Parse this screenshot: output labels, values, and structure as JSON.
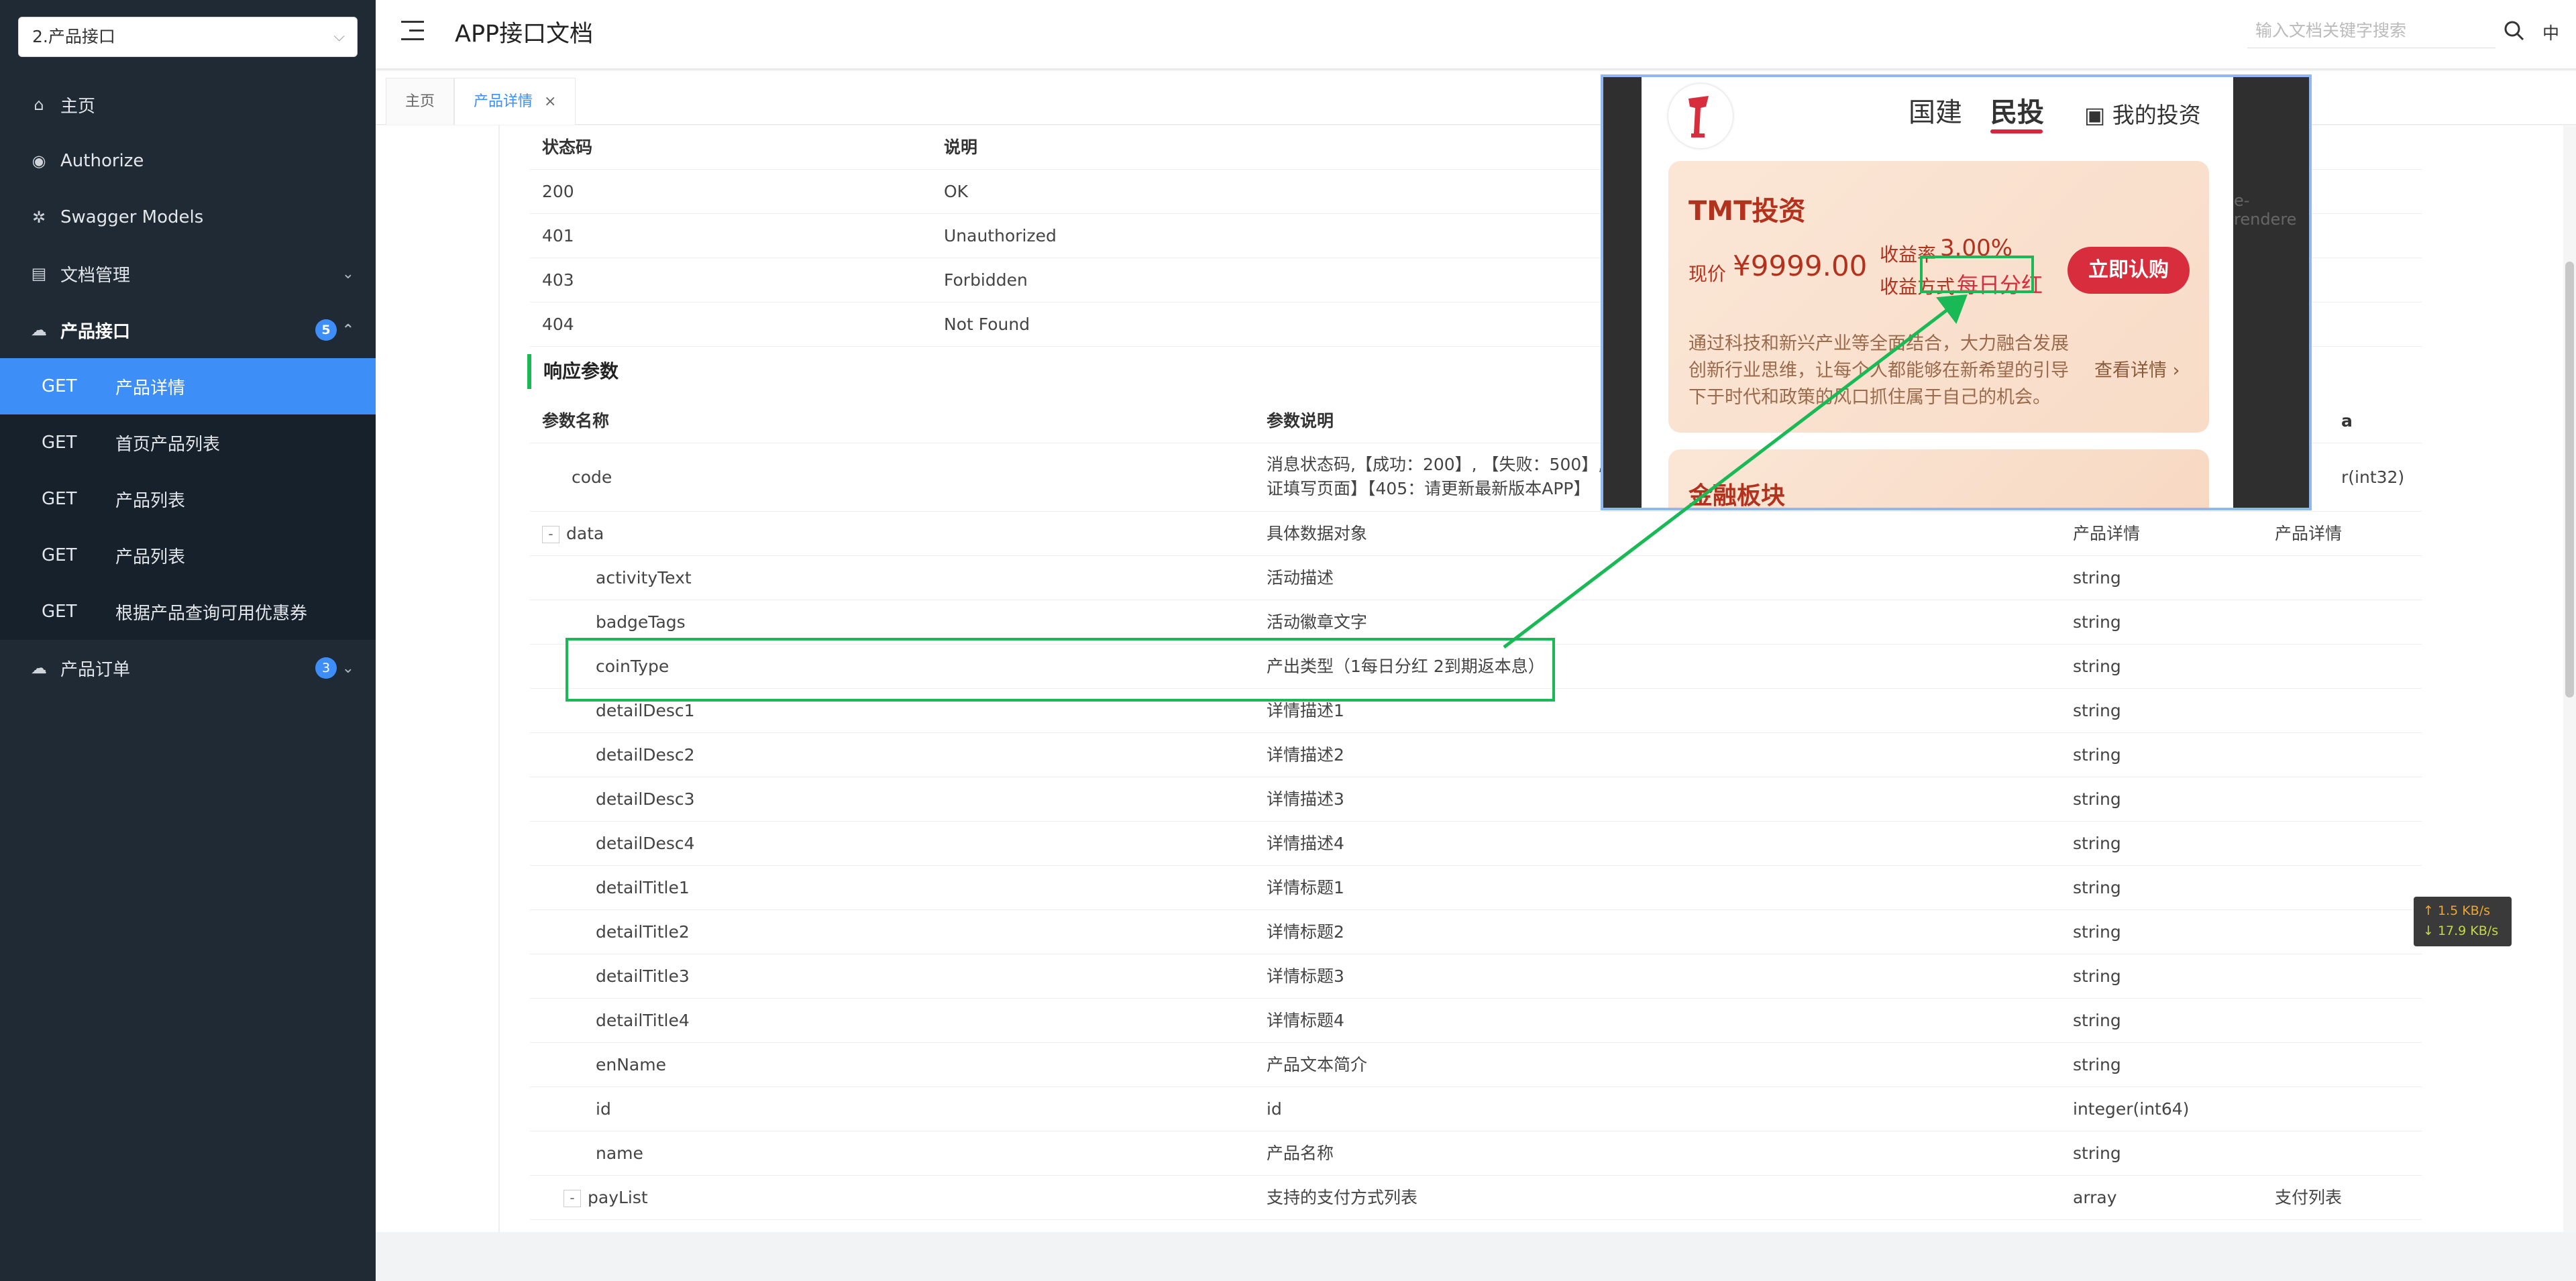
{
  "sidebar": {
    "group_select": "2.产品接口",
    "items": [
      {
        "icon": "home-icon",
        "icon_char": "⌂",
        "label": "主页"
      },
      {
        "icon": "authorize-icon",
        "icon_char": "◉",
        "label": "Authorize"
      },
      {
        "icon": "swagger-models-icon",
        "icon_char": "✲",
        "label": "Swagger Models"
      },
      {
        "icon": "document-manage-icon",
        "icon_char": "▤",
        "label": "文档管理"
      },
      {
        "icon": "cloud-icon",
        "icon_char": "☁",
        "label": "产品接口",
        "badge": "5"
      },
      {
        "icon": "cloud-icon",
        "icon_char": "☁",
        "label": "产品订单",
        "badge": "3"
      }
    ],
    "sub_items": [
      {
        "method": "GET",
        "label": "产品详情"
      },
      {
        "method": "GET",
        "label": "首页产品列表"
      },
      {
        "method": "GET",
        "label": "产品列表"
      },
      {
        "method": "GET",
        "label": "产品列表"
      },
      {
        "method": "GET",
        "label": "根据产品查询可用优惠券"
      }
    ]
  },
  "header": {
    "title": "APP接口文档",
    "search_placeholder": "输入文档关键字搜索",
    "lang": "中"
  },
  "tabs": [
    {
      "label": "主页"
    },
    {
      "label": "产品详情",
      "close": "×"
    }
  ],
  "status_table": {
    "headers": [
      "状态码",
      "说明"
    ],
    "rows": [
      [
        "200",
        "OK"
      ],
      [
        "401",
        "Unauthorized"
      ],
      [
        "403",
        "Forbidden"
      ],
      [
        "404",
        "Not Found"
      ]
    ]
  },
  "response": {
    "title": "响应参数",
    "headers": [
      "参数名称",
      "参数说明"
    ],
    "header_schema_fragment": "a",
    "code_row": {
      "name": "code",
      "desc_line1": "消息状态码,【成功：200】, 【失败：500】,",
      "desc_line2": "证填写页面】【405：请更新最新版本APP】",
      "type_fragment": "r(int32)"
    },
    "data_row": {
      "toggle": "-",
      "name": "data",
      "desc": "具体数据对象",
      "type": "产品详情",
      "schema": "产品详情"
    },
    "rows": [
      {
        "name": "activityText",
        "desc": "活动描述",
        "type": "string"
      },
      {
        "name": "badgeTags",
        "desc": "活动徽章文字",
        "type": "string"
      },
      {
        "name": "coinType",
        "desc": "产出类型（1每日分红 2到期返本息）",
        "type": "string"
      },
      {
        "name": "detailDesc1",
        "desc": "详情描述1",
        "type": "string"
      },
      {
        "name": "detailDesc2",
        "desc": "详情描述2",
        "type": "string"
      },
      {
        "name": "detailDesc3",
        "desc": "详情描述3",
        "type": "string"
      },
      {
        "name": "detailDesc4",
        "desc": "详情描述4",
        "type": "string"
      },
      {
        "name": "detailTitle1",
        "desc": "详情标题1",
        "type": "string"
      },
      {
        "name": "detailTitle2",
        "desc": "详情标题2",
        "type": "string"
      },
      {
        "name": "detailTitle3",
        "desc": "详情标题3",
        "type": "string"
      },
      {
        "name": "detailTitle4",
        "desc": "详情标题4",
        "type": "string"
      },
      {
        "name": "enName",
        "desc": "产品文本简介",
        "type": "string"
      },
      {
        "name": "id",
        "desc": "id",
        "type": "integer(int64)"
      },
      {
        "name": "name",
        "desc": "产品名称",
        "type": "string"
      }
    ],
    "paylist_row": {
      "toggle": "-",
      "name": "payList",
      "desc": "支持的支付方式列表",
      "type": "array",
      "schema": "支付列表"
    }
  },
  "overlay": {
    "tab1": "国建",
    "tab2": "民投",
    "my_invest": "我的投资",
    "product_name": "TMT投资",
    "price_label": "现价",
    "price": "¥9999.00",
    "rate_label": "收益率",
    "rate": "3.00%",
    "mode_label": "收益方式",
    "mode": "每日分红",
    "buy_button": "立即认购",
    "desc1": "通过科技和新兴产业等全面结合，大力融合发展",
    "desc2": "创新行业思维，让每个人都能够在新希望的引导",
    "desc3": "下于时代和政策的风口抓住属于自己的机会。",
    "more": "查看详情 ›",
    "card2_title": "金融板块",
    "bg_fragment": "e-rendere"
  },
  "speed": {
    "up": "↑ 1.5 KB/s",
    "down": "↓ 17.9 KB/s"
  },
  "colors": {
    "sidebar_bg": "#1f2a35",
    "accent": "#3e8ef7",
    "highlight": "#19b955",
    "brand_red": "#d72d3c"
  }
}
